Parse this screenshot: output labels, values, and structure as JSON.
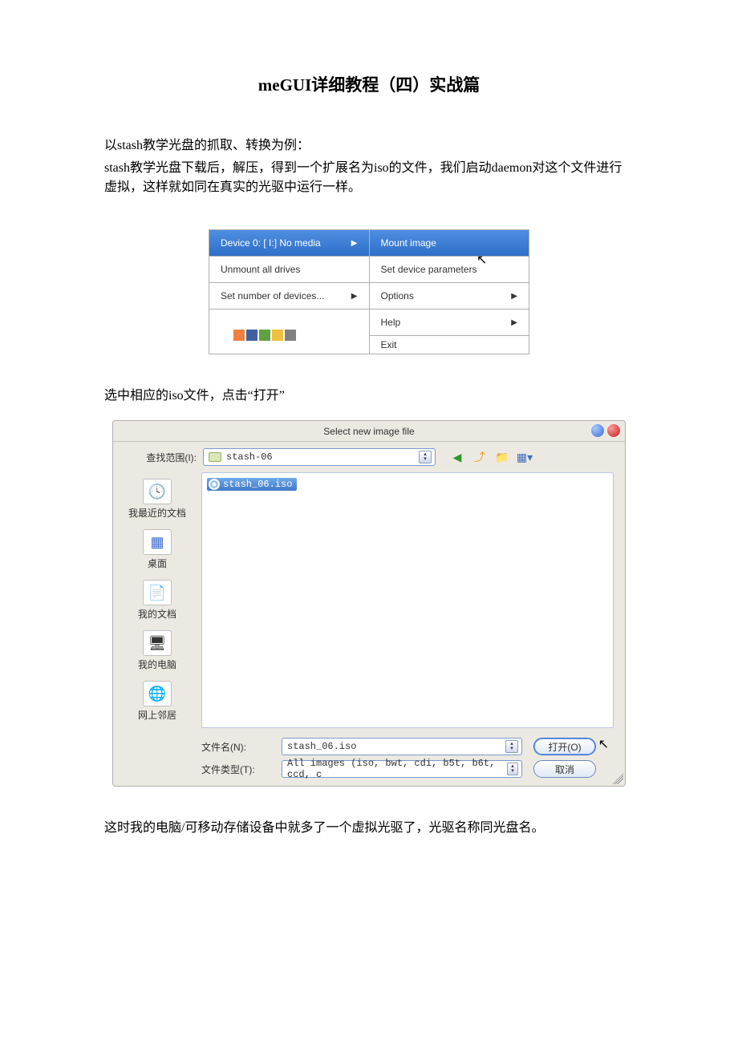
{
  "title": "meGUI详细教程（四）实战篇",
  "para1": "以stash教学光盘的抓取、转换为例：",
  "para2": "stash教学光盘下载后，解压，得到一个扩展名为iso的文件，我们启动daemon对这个文件进行虚拟，这样就如同在真实的光驱中运行一样。",
  "para3": "选中相应的iso文件，点击“打开”",
  "para4": "这时我的电脑/可移动存储设备中就多了一个虚拟光驱了，光驱名称同光盘名。",
  "menu": {
    "device0": "Device 0: [ I:] No media",
    "unmount": "Unmount all drives",
    "setnum": "Set number of devices...",
    "mount": "Mount image",
    "setparams": "Set device parameters",
    "options": "Options",
    "help": "Help",
    "exit": "Exit"
  },
  "dialog": {
    "title": "Select new image file",
    "lookin_label": "查找范围(I):",
    "lookin_value": "stash-06",
    "places": {
      "recent": "我最近的文档",
      "desktop": "桌面",
      "mydocs": "我的文档",
      "mycomp": "我的电脑",
      "network": "网上邻居"
    },
    "file_item": "stash_06.iso",
    "filename_label": "文件名(N):",
    "filename_value": "stash_06.iso",
    "filetype_label": "文件类型(T):",
    "filetype_value": "All images (iso, bwt, cdi, b5t, b6t, ccd, c",
    "open_btn": "打开(O)",
    "cancel_btn": "取消"
  }
}
